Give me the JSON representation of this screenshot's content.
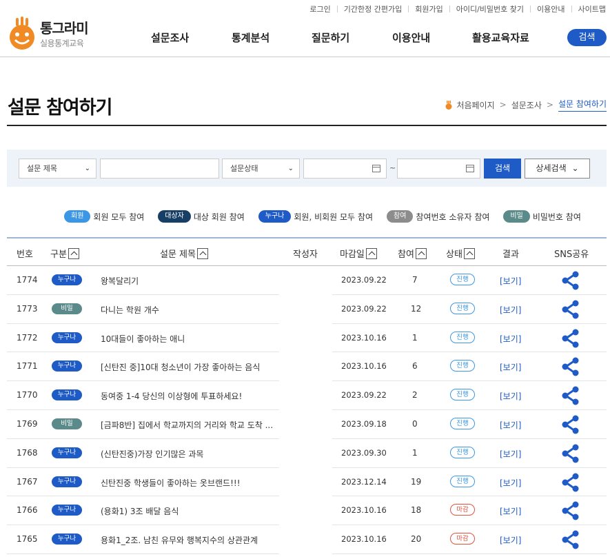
{
  "util_links": [
    "로그인",
    "기간한정 간편가입",
    "회원가입",
    "아이디/비밀번호 찾기",
    "이용안내",
    "사이트맵"
  ],
  "logo": {
    "title": "통그라미",
    "subtitle": "실용통계교육"
  },
  "nav": [
    "설문조사",
    "통계분석",
    "질문하기",
    "이용안내",
    "활용교육자료"
  ],
  "nav_search_label": "검색",
  "page_title": "설문 참여하기",
  "breadcrumb": [
    "처음페이지",
    "설문조사",
    "설문 참여하기"
  ],
  "search": {
    "select_title": "설문 제목",
    "title_input_value": "",
    "select_status": "설문상태",
    "date_from": "",
    "date_sep": "~",
    "date_to": "",
    "search_label": "검색",
    "detail_label": "상세검색"
  },
  "legend": [
    {
      "badge": "회원",
      "text": "회원 모두 참여",
      "color": "#3b97e6"
    },
    {
      "badge": "대상자",
      "text": "대상 회원 참여",
      "color": "#173f66"
    },
    {
      "badge": "누구나",
      "text": "회원, 비회원 모두 참여",
      "color": "#1e5bc6"
    },
    {
      "badge": "참여",
      "text": "참여번호 소유자 참여",
      "color": "#8c8c8c"
    },
    {
      "badge": "비밀",
      "text": "비밀번호 참여",
      "color": "#5a8b8a"
    }
  ],
  "table": {
    "headers": {
      "no": "번호",
      "type": "구분",
      "title": "설문 제목",
      "author": "작성자",
      "deadline": "마감일",
      "count": "참여",
      "status": "상태",
      "result": "결과",
      "sns": "SNS공유"
    },
    "rows": [
      {
        "no": "1774",
        "type": "누구나",
        "title": "왕복달리기",
        "deadline": "2023.09.22",
        "count": "7",
        "status": "진행",
        "result": "[보기]"
      },
      {
        "no": "1773",
        "type": "비밀",
        "title": "다니는 학원 개수",
        "deadline": "2023.09.22",
        "count": "12",
        "status": "진행",
        "result": "[보기]"
      },
      {
        "no": "1772",
        "type": "누구나",
        "title": "10대들이 좋아하는 애니",
        "deadline": "2023.10.16",
        "count": "1",
        "status": "진행",
        "result": "[보기]"
      },
      {
        "no": "1771",
        "type": "누구나",
        "title": "[신탄진 중]10대 청소년이 가장 좋아하는 음식",
        "deadline": "2023.10.16",
        "count": "6",
        "status": "진행",
        "result": "[보기]"
      },
      {
        "no": "1770",
        "type": "누구나",
        "title": "동여중 1-4 당신의 이상형에 투표하세요!",
        "deadline": "2023.09.22",
        "count": "2",
        "status": "진행",
        "result": "[보기]"
      },
      {
        "no": "1769",
        "type": "비밀",
        "title": "[금파8반] 집에서 학교까지의 거리와 학교 도착 ...",
        "deadline": "2023.09.18",
        "count": "0",
        "status": "진행",
        "result": "[보기]"
      },
      {
        "no": "1768",
        "type": "누구나",
        "title": "(신탄진중)가장 인기많은 과목",
        "deadline": "2023.09.30",
        "count": "1",
        "status": "진행",
        "result": "[보기]"
      },
      {
        "no": "1767",
        "type": "누구나",
        "title": "신탄진중 학생들이 좋아하는 옷브랜드!!!",
        "deadline": "2023.12.14",
        "count": "19",
        "status": "진행",
        "result": "[보기]"
      },
      {
        "no": "1766",
        "type": "누구나",
        "title": "(용화1) 3조 배달 음식",
        "deadline": "2023.10.16",
        "count": "18",
        "status": "마감",
        "result": "[보기]"
      },
      {
        "no": "1765",
        "type": "누구나",
        "title": "용화1_2조. 남친 유무와 행복지수의 상관관계",
        "deadline": "2023.10.16",
        "count": "20",
        "status": "마감",
        "result": "[보기]"
      }
    ]
  },
  "colors": {
    "brand_blue": "#1e5bc6",
    "badge_anyone": "#1e5bc6",
    "badge_secret": "#5a8b8a",
    "status_open": "#3b97e6",
    "status_closed": "#e0533a"
  }
}
